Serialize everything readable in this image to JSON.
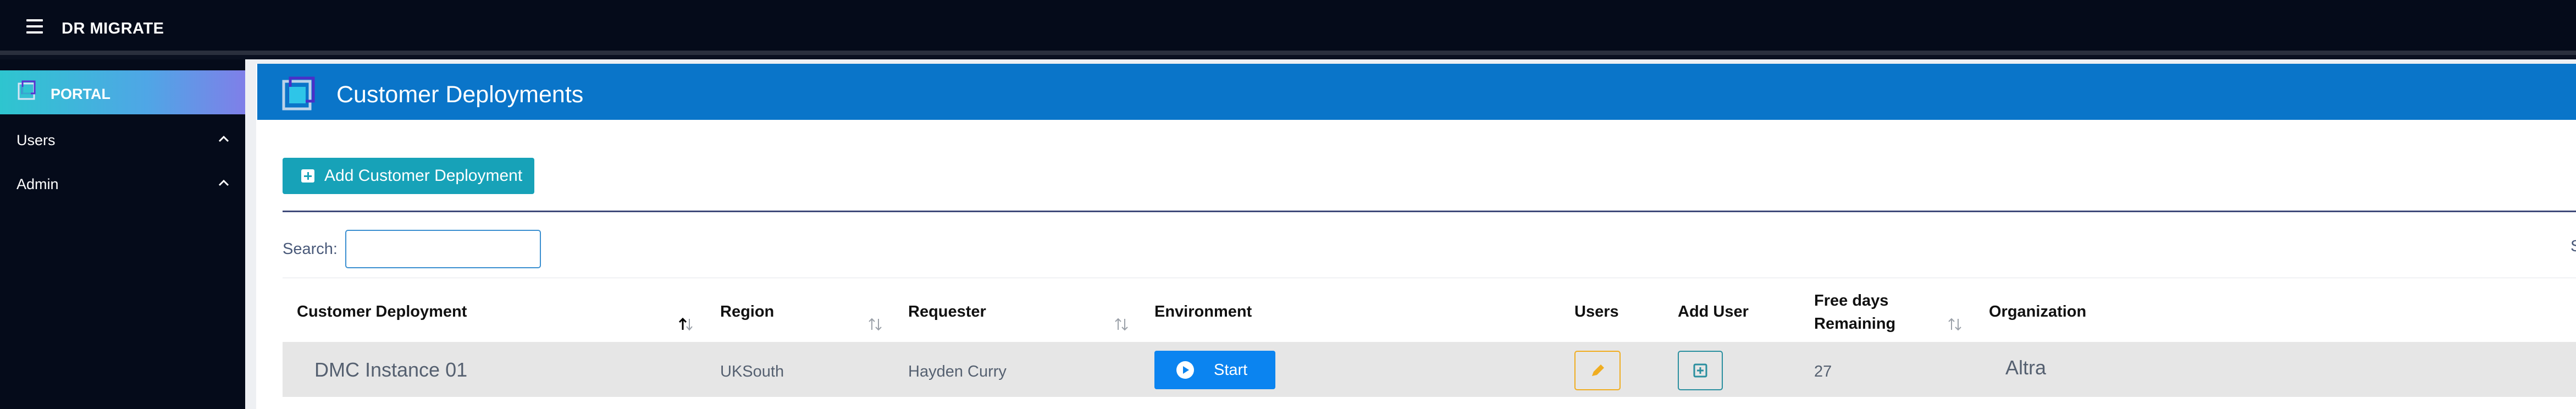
{
  "app": {
    "brand": "DR MIGRATE"
  },
  "sidebar": {
    "portal_label": "PORTAL",
    "items": [
      {
        "label": "Users"
      },
      {
        "label": "Admin"
      }
    ]
  },
  "header": {
    "title": "Customer Deployments"
  },
  "toolbar": {
    "add_label": "Add Customer Deployment"
  },
  "search": {
    "label": "Search:",
    "value": "",
    "right_letter": "S"
  },
  "table": {
    "columns": [
      "Customer Deployment",
      "Region",
      "Requester",
      "Environment",
      "Users",
      "Add User",
      "Free days",
      "Remaining",
      "Organization"
    ],
    "rows": [
      {
        "customer_deployment": "DMC Instance 01",
        "region": "UKSouth",
        "requester": "Hayden Curry",
        "environment_action": "Start",
        "free_days_remaining": "27",
        "organization": "Altra"
      }
    ]
  },
  "colors": {
    "topbar": "#050b1a",
    "header": "#0a75c9",
    "add_button": "#17a2b8",
    "start_button": "#0b84f0",
    "edit_border": "#f0ad20",
    "adduser_border": "#2a8f9f"
  },
  "icons": [
    "hamburger-icon",
    "portal-icon",
    "chevron-up-icon",
    "deployments-icon",
    "plus-square-icon",
    "sort-icon",
    "play-circle-icon",
    "pencil-icon"
  ]
}
